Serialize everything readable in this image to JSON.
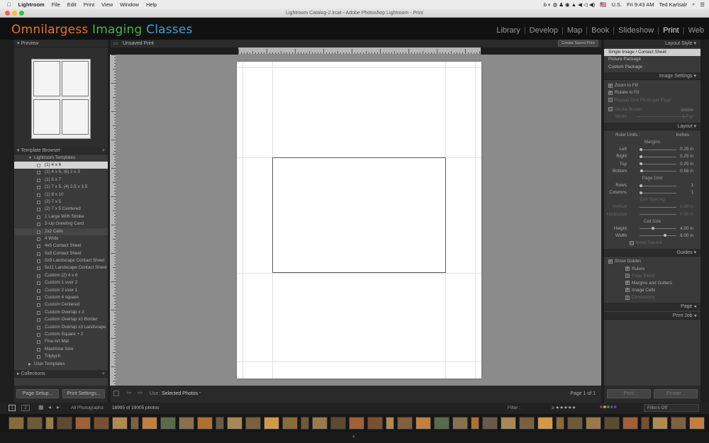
{
  "menubar": {
    "app": "Lightroom",
    "items": [
      "File",
      "Edit",
      "Print",
      "View",
      "Window",
      "Help"
    ],
    "flag": "U.S.",
    "time": "Fri 9:43 AM",
    "user": "Ted Karlsalr"
  },
  "window_title": "Lightroom Catalog-2.lrcat - Adobe Photoshop Lightroom - Print",
  "identity": {
    "word1": "Omnilargess",
    "word2": "Imaging",
    "word3": "Classes",
    "color1": "#e8702a",
    "color2": "#4caf50",
    "color3": "#3aa0d8"
  },
  "modules": [
    "Library",
    "Develop",
    "Map",
    "Book",
    "Slideshow",
    "Print",
    "Web"
  ],
  "active_module": "Print",
  "left": {
    "preview_label": "Preview",
    "template_browser_label": "Template Browser",
    "lightroom_templates_label": "Lightroom Templates",
    "templates": [
      "(1) 4 x 6",
      "(1) 4 x 6, (6) 2 x 3",
      "(1) 5 x 7",
      "(1) 7 x 5, (4) 2.5 x 3.5",
      "(1) 8 x 10",
      "(2) 7 x 5",
      "(2) 7 x 5 Centered",
      "1 Large With Stroke",
      "2-Up Greeting Card",
      "2x2 Cells",
      "4 Wide",
      "4x5 Contact Sheet",
      "5x8 Contact Sheet",
      "5x9 Landscape Contact Sheet",
      "5x11 Landscape Contact Sheet",
      "Custom (2) 4 x 6",
      "Custom 1 over 2",
      "Custom 2 over 1",
      "Custom 4 square",
      "Custom Centered",
      "Custom Overlap x 3",
      "Custom Overlap x3 Border",
      "Custom Overlap x3 Landscape",
      "Custom Square + 2",
      "Fine Art Mat",
      "Maximize Size",
      "Triptych"
    ],
    "user_templates_label": "User Templates",
    "collections_label": "Collections",
    "page_setup_label": "Page Setup...",
    "print_settings_label": "Print Settings..."
  },
  "center": {
    "title": "Unsaved Print",
    "create_saved_label": "Create Saved Print",
    "use_label": "Use:",
    "use_value": "Selected Photos",
    "page_count": "Page 1 of 1"
  },
  "right": {
    "layout_style_label": "Layout Style",
    "layout_styles": [
      "Single Image / Contact Sheet",
      "Picture Package",
      "Custom Package"
    ],
    "image_settings_label": "Image Settings",
    "image_settings": {
      "zoom": "Zoom to Fill",
      "rotate": "Rotate to Fit",
      "repeat": "Repeat One Photo per Page",
      "stroke": "Stroke Border",
      "width_label": "Width",
      "width_val": "1.0 pt"
    },
    "layout_label": "Layout",
    "ruler_units_label": "Ruler Units :",
    "ruler_units_value": "Inches",
    "margins_label": "Margins",
    "margins": [
      {
        "label": "Left",
        "value": "0.25 in",
        "pos": 0
      },
      {
        "label": "Right",
        "value": "0.25 in",
        "pos": 0
      },
      {
        "label": "Top",
        "value": "0.25 in",
        "pos": 0
      },
      {
        "label": "Bottom",
        "value": "0.56 in",
        "pos": 0.02
      }
    ],
    "page_grid_label": "Page Grid",
    "grid": [
      {
        "label": "Rows",
        "value": "1",
        "pos": 0
      },
      {
        "label": "Columns",
        "value": "1",
        "pos": 0
      }
    ],
    "cell_spacing_label": "Cell Spacing",
    "spacing": [
      {
        "label": "Vertical",
        "value": "0.00 in"
      },
      {
        "label": "Horizontal",
        "value": "0.00 in"
      }
    ],
    "cell_size_label": "Cell Size",
    "cell_size": [
      {
        "label": "Height",
        "value": "4.00 in",
        "pos": 0.35
      },
      {
        "label": "Width",
        "value": "6.00 in",
        "pos": 0.7
      }
    ],
    "keep_square_label": "Keep Square",
    "guides_label": "Guides",
    "show_guides_label": "Show Guides",
    "guides": [
      "Rulers",
      "Page Bleed",
      "Margins and Gutters",
      "Image Cells",
      "Dimensions"
    ],
    "page_label": "Page",
    "print_job_label": "Print Job",
    "print_label": "Print",
    "printer_label": "Printer..."
  },
  "filmstrip": {
    "source": "All Photographs",
    "count": "18995 of 19005 photos",
    "filter_label": "Filter :",
    "filters_off": "Filters Off"
  }
}
